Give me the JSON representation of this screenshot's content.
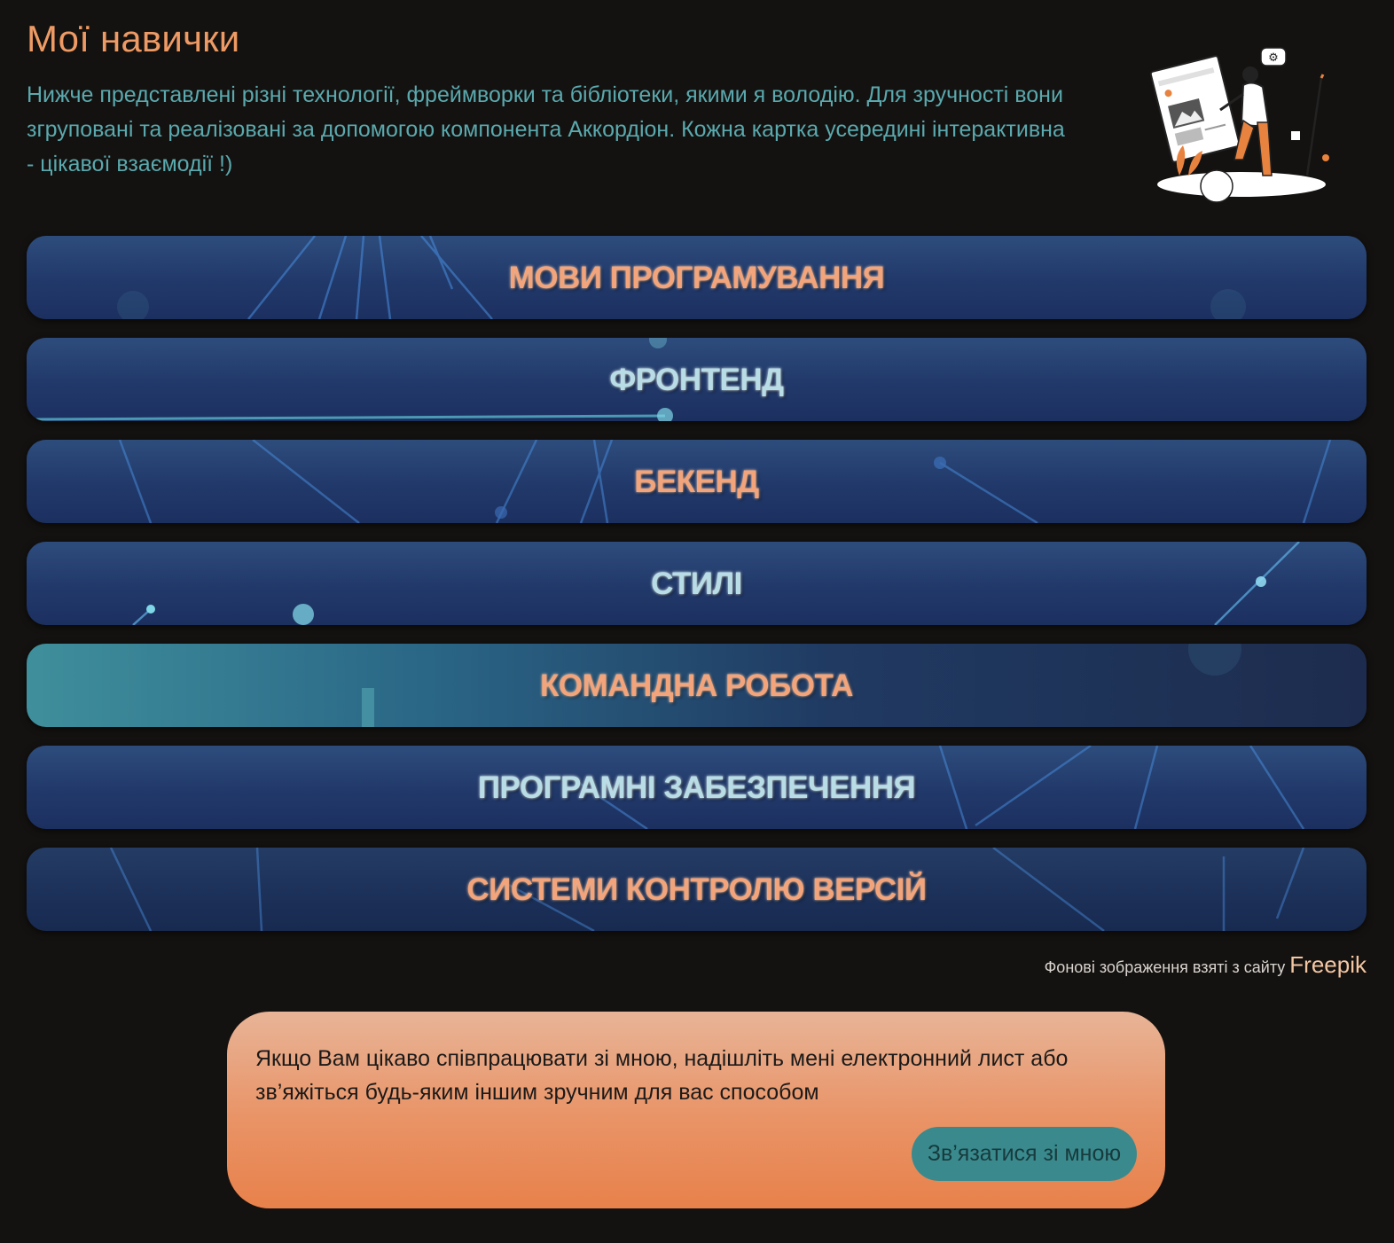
{
  "header": {
    "title": "Мої навички",
    "intro": "Нижче представлені різні технології, фреймворки та бібліотеки, якими я володію. Для зручності вони згруповані та реалізовані за допомогою компонента Аккордіон. Кожна картка усередині інтерактивна - цікавої взаємодії !)",
    "illustration_icon": "designer-illustration-icon"
  },
  "accordion": {
    "items": [
      {
        "label": "МОВИ ПРОГРАМУВАННЯ",
        "color": "orange"
      },
      {
        "label": "ФРОНТЕНД",
        "color": "teal"
      },
      {
        "label": "БЕКЕНД",
        "color": "orange"
      },
      {
        "label": "СТИЛІ",
        "color": "teal"
      },
      {
        "label": "КОМАНДНА РОБОТА",
        "color": "orange"
      },
      {
        "label": "ПРОГРАМНІ ЗАБЕЗПЕЧЕННЯ",
        "color": "teal"
      },
      {
        "label": "СИСТЕМИ КОНТРОЛЮ ВЕРСІЙ",
        "color": "orange"
      }
    ]
  },
  "credit": {
    "text": "Фонові зображення взяті з сайту",
    "link_label": "Freepik"
  },
  "cta": {
    "text": "Якщо Вам цікаво співпрацювати зі мною, надішліть мені електронний лист або зв’яжіться будь-яким іншим зручним для вас способом",
    "button_label": "Зв’язатися зі мною"
  },
  "colors": {
    "background": "#141210",
    "accent_orange": "#ee9a64",
    "accent_teal": "#5aa9ae",
    "card_blue": "#21396a",
    "cta_orange": "#e99366",
    "button_teal": "#3a8a8d"
  }
}
